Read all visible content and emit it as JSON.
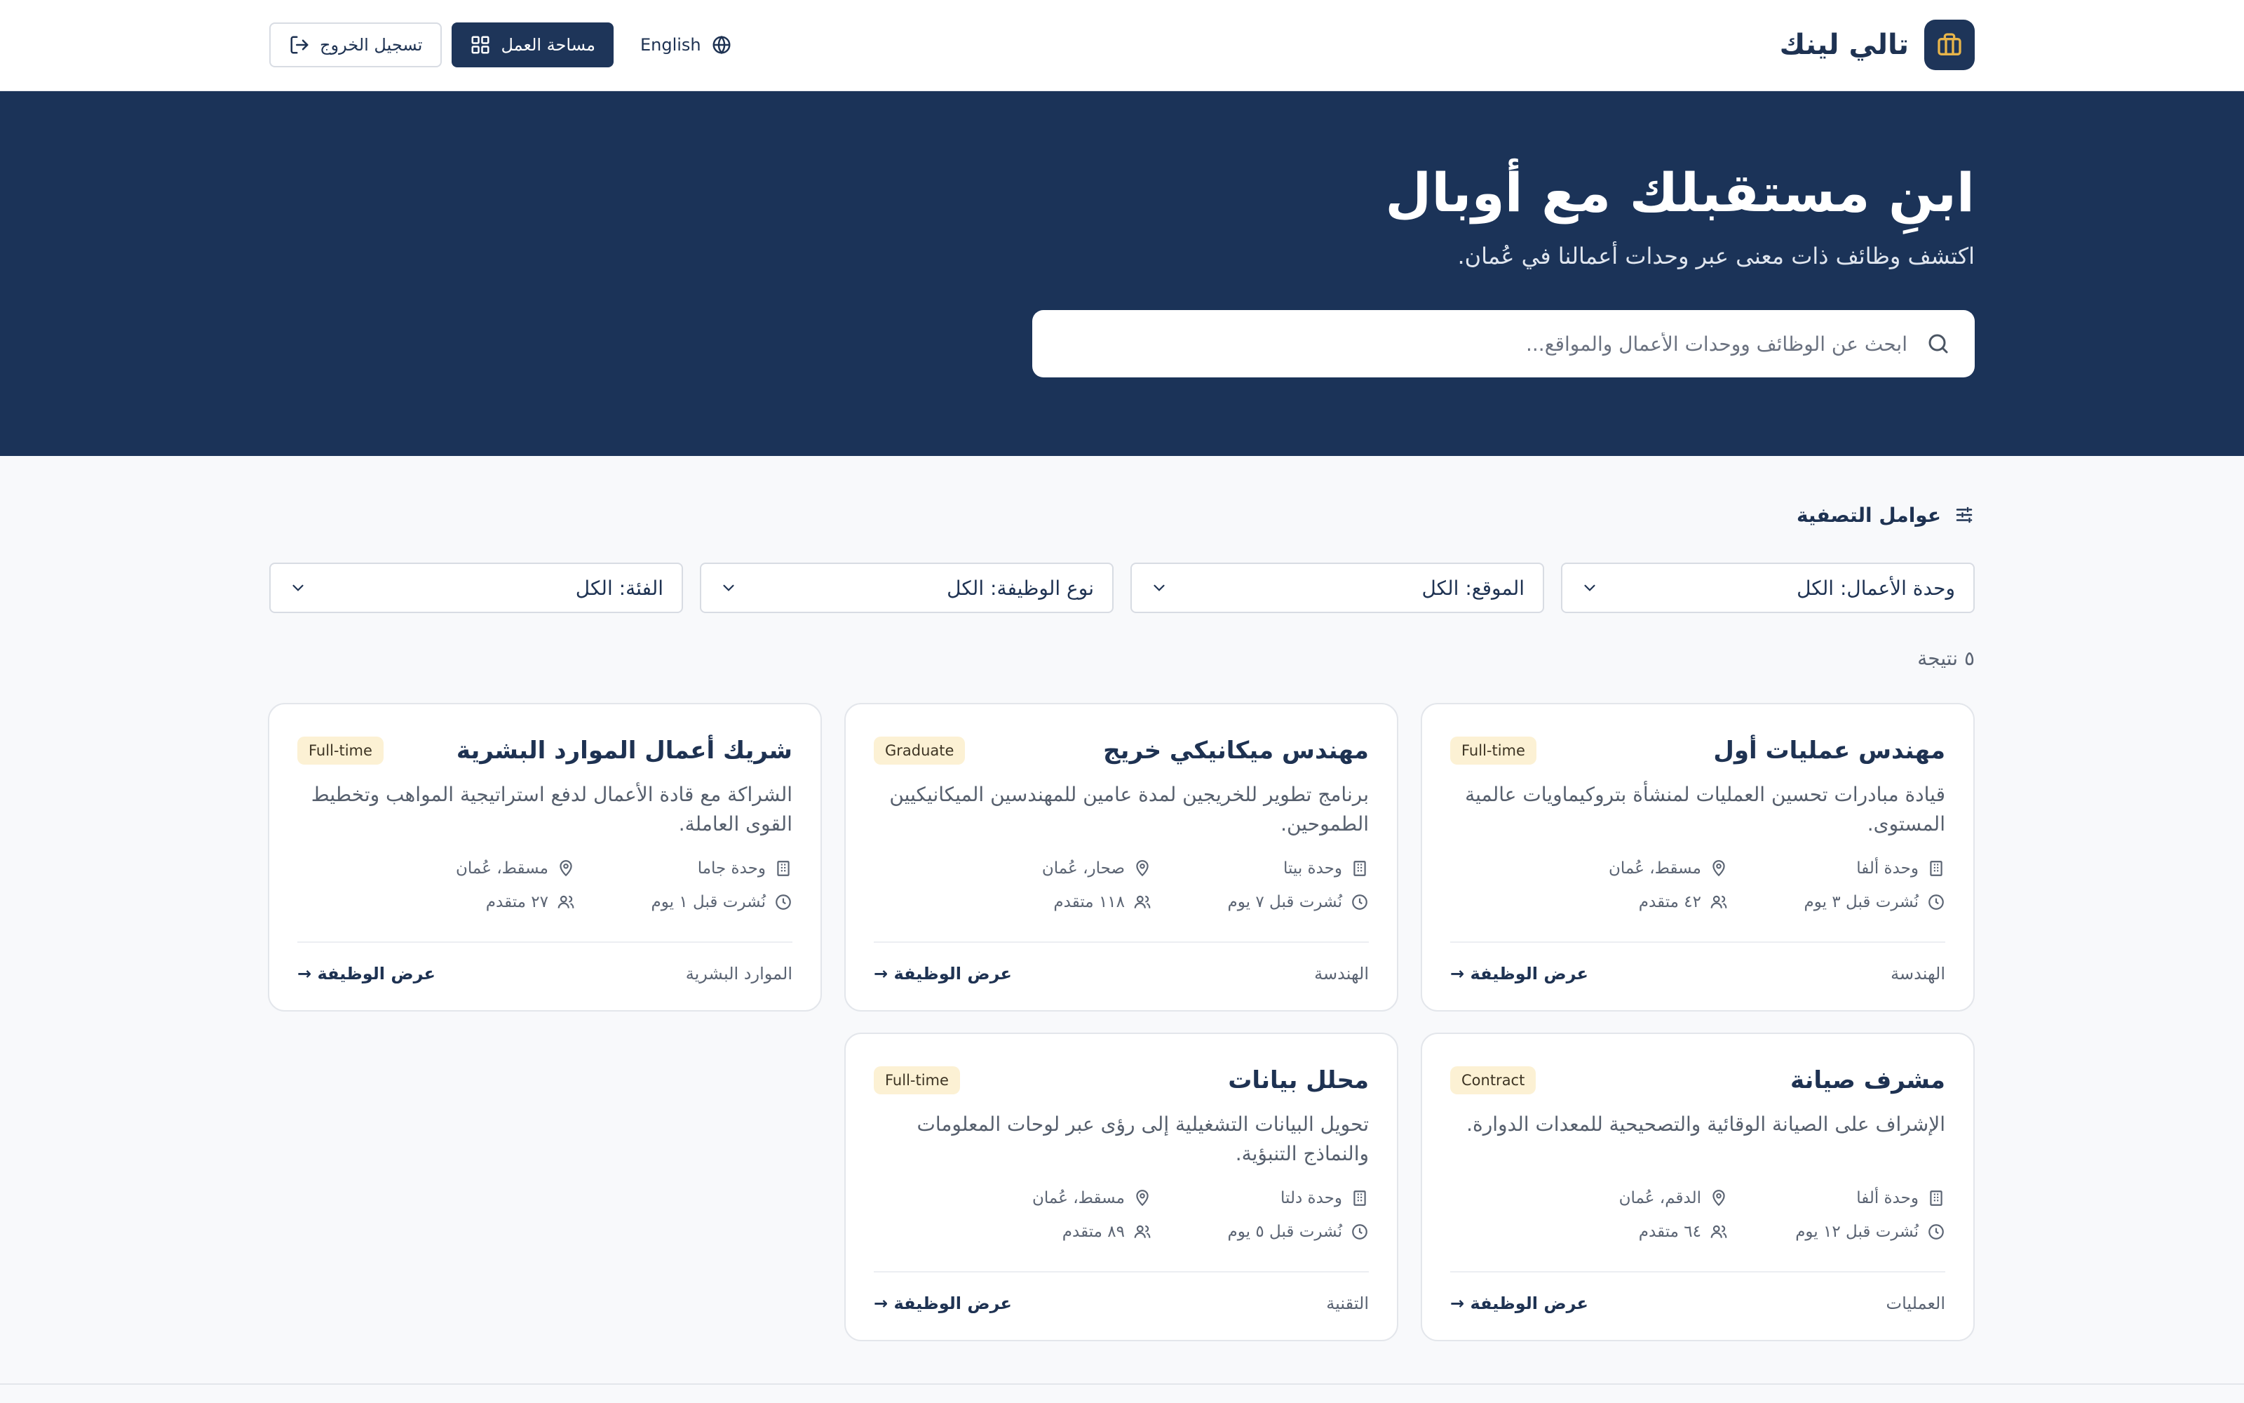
{
  "header": {
    "brand_name": "تالي لينك",
    "language_label": "English",
    "workspace_label": "مساحة العمل",
    "logout_label": "تسجيل الخروج"
  },
  "hero": {
    "title": "ابنِ مستقبلك مع أوبال",
    "subtitle": "اكتشف وظائف ذات معنى عبر وحدات أعمالنا في عُمان.",
    "search_placeholder": "ابحث عن الوظائف ووحدات الأعمال والمواقع..."
  },
  "filters": {
    "heading": "عوامل التصفية",
    "business_unit": "وحدة الأعمال: الكل",
    "location": "الموقع: الكل",
    "job_type": "نوع الوظيفة: الكل",
    "category": "الفئة: الكل"
  },
  "results_count": "٥ نتيجة",
  "jobs": [
    {
      "title": "مهندس عمليات أول",
      "type": "Full-time",
      "description": "قيادة مبادرات تحسين العمليات لمنشأة بتروكيماويات عالمية المستوى.",
      "unit": "وحدة ألفا",
      "location": "مسقط، عُمان",
      "posted": "نُشرت قبل ٣ يوم",
      "applicants": "٤٢ متقدم",
      "category": "الهندسة",
      "view_label": "عرض الوظيفة →"
    },
    {
      "title": "مهندس ميكانيكي خريج",
      "type": "Graduate",
      "description": "برنامج تطوير للخريجين لمدة عامين للمهندسين الميكانيكيين الطموحين.",
      "unit": "وحدة بيتا",
      "location": "صحار، عُمان",
      "posted": "نُشرت قبل ٧ يوم",
      "applicants": "١١٨ متقدم",
      "category": "الهندسة",
      "view_label": "عرض الوظيفة →"
    },
    {
      "title": "شريك أعمال الموارد البشرية",
      "type": "Full-time",
      "description": "الشراكة مع قادة الأعمال لدفع استراتيجية المواهب وتخطيط القوى العاملة.",
      "unit": "وحدة جاما",
      "location": "مسقط، عُمان",
      "posted": "نُشرت قبل ١ يوم",
      "applicants": "٢٧ متقدم",
      "category": "الموارد البشرية",
      "view_label": "عرض الوظيفة →"
    },
    {
      "title": "مشرف صيانة",
      "type": "Contract",
      "description": "الإشراف على الصيانة الوقائية والتصحيحية للمعدات الدوارة.",
      "unit": "وحدة ألفا",
      "location": "الدقم، عُمان",
      "posted": "نُشرت قبل ١٢ يوم",
      "applicants": "٦٤ متقدم",
      "category": "العمليات",
      "view_label": "عرض الوظيفة →"
    },
    {
      "title": "محلل بيانات",
      "type": "Full-time",
      "description": "تحويل البيانات التشغيلية إلى رؤى عبر لوحات المعلومات والنماذج التنبؤية.",
      "unit": "وحدة دلتا",
      "location": "مسقط، عُمان",
      "posted": "نُشرت قبل ٥ يوم",
      "applicants": "٨٩ متقدم",
      "category": "التقنية",
      "view_label": "عرض الوظيفة →"
    }
  ]
}
